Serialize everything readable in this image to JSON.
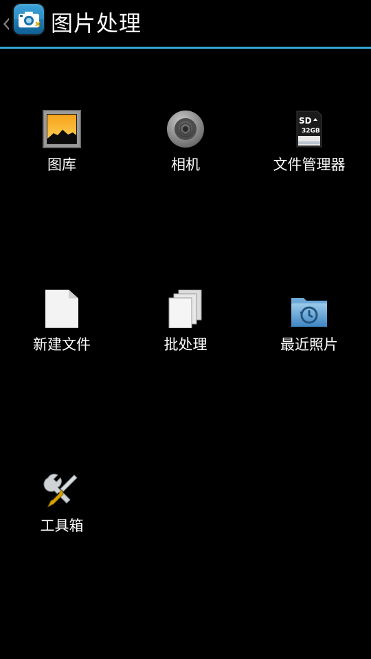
{
  "header": {
    "title": "图片处理",
    "up_icon": "chevron-left-icon",
    "app_icon": "camera-icon",
    "accent_color": "#33a8d6"
  },
  "grid": {
    "items": [
      {
        "label": "图库",
        "icon": "gallery-icon"
      },
      {
        "label": "相机",
        "icon": "camera-lens-icon"
      },
      {
        "label": "文件管理器",
        "icon": "sd-card-icon",
        "badge": "SD",
        "capacity": "32GB"
      },
      {
        "label": "新建文件",
        "icon": "new-file-icon"
      },
      {
        "label": "批处理",
        "icon": "batch-pages-icon"
      },
      {
        "label": "最近照片",
        "icon": "recent-folder-icon"
      },
      {
        "label": "工具箱",
        "icon": "tools-icon"
      }
    ]
  }
}
